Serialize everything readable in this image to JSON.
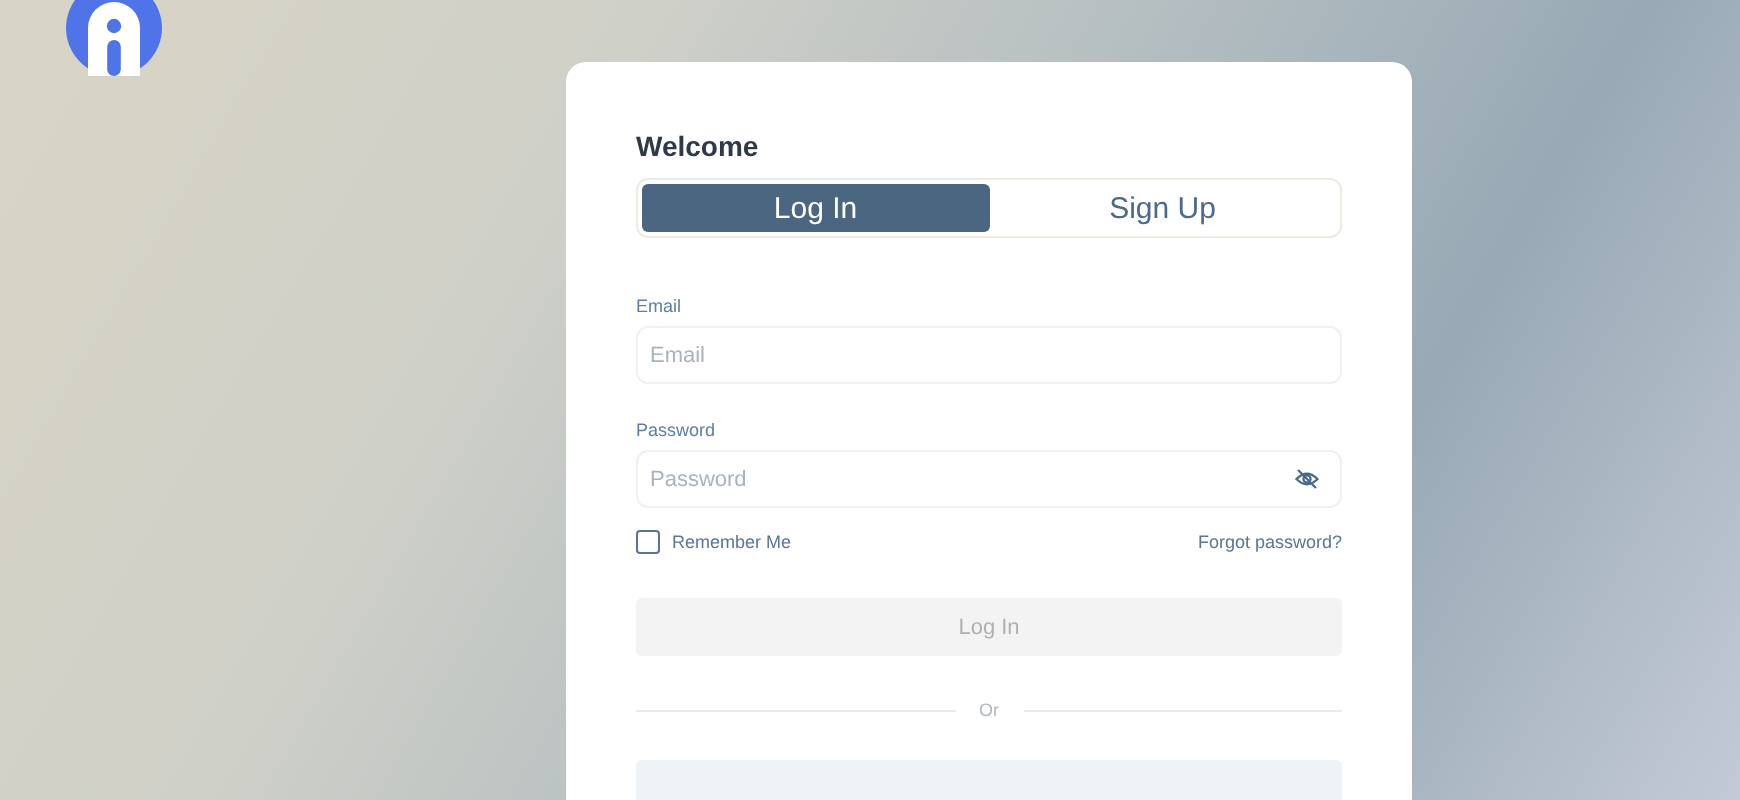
{
  "title": "Welcome",
  "tabs": [
    {
      "label": "Log In",
      "selected": true
    },
    {
      "label": "Sign Up",
      "selected": false
    }
  ],
  "fields": [
    {
      "kind": "text",
      "label": "Email",
      "placeholder": "Email"
    },
    {
      "kind": "password",
      "label": "Password",
      "placeholder": "Password"
    }
  ],
  "remember": {
    "label": "Remember Me",
    "checked": false
  },
  "forgot_link": "Forgot password?",
  "submit": {
    "label": "Log In",
    "disabled": true
  },
  "divider": "Or"
}
